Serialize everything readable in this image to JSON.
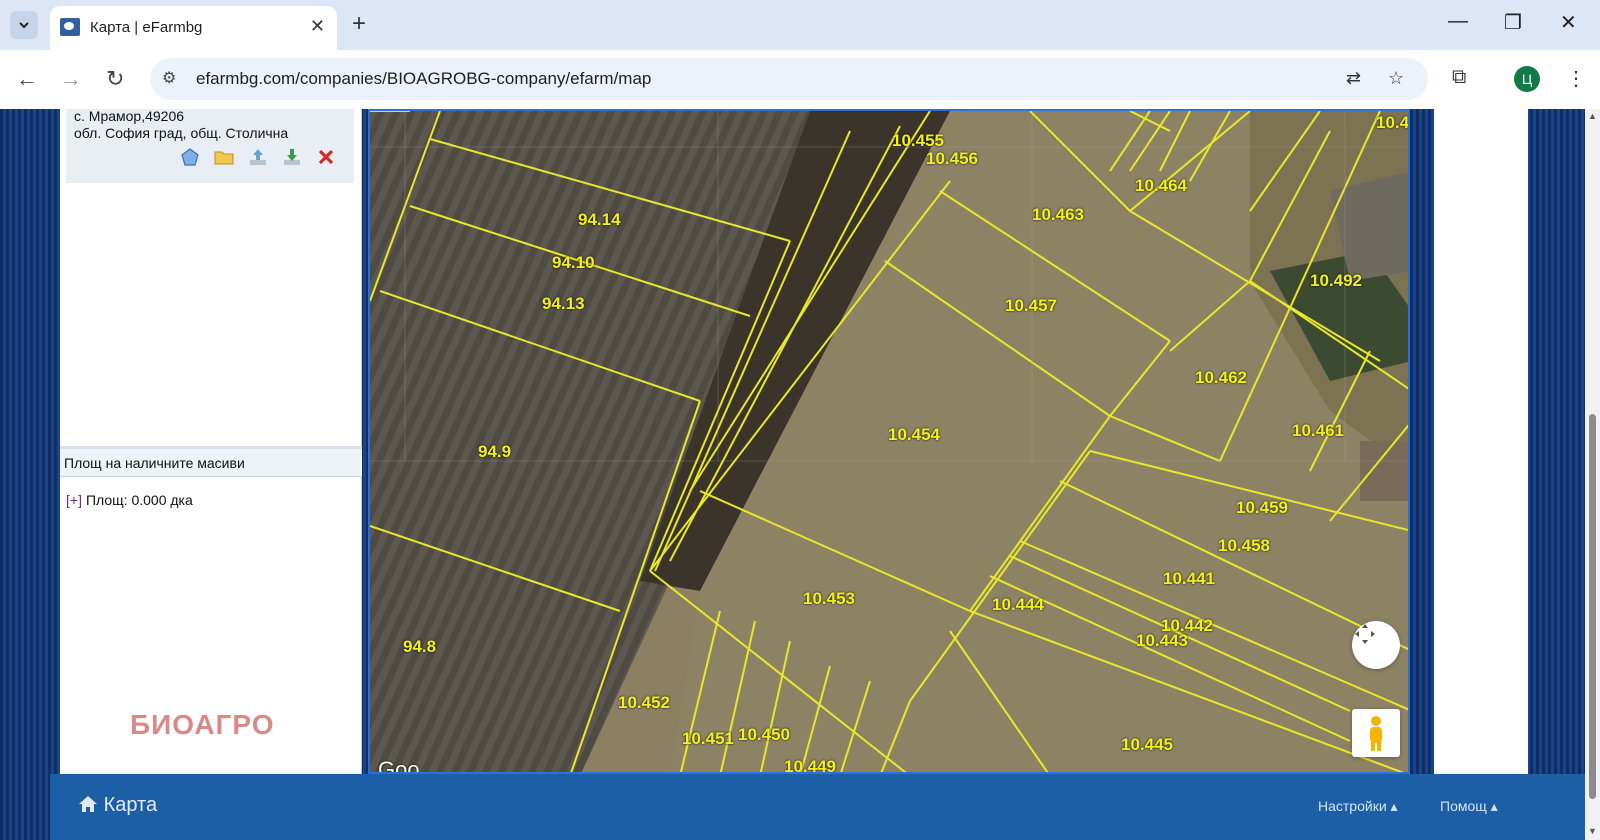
{
  "browser": {
    "tab_title": "Карта | eFarmbg",
    "url": "efarmbg.com/companies/BIOAGROBG-company/efarm/map",
    "profile_letter": "Ц"
  },
  "location": {
    "line1": "с. Мрамор,49206",
    "line2": "обл. София град, общ. Столична"
  },
  "panel": {
    "section_title": "Площ на наличните масиви",
    "area_toggle": "[+]",
    "area_text": "Площ: 0.000 дка",
    "brand": "БИОАГРО"
  },
  "map": {
    "parcels": [
      "10.455",
      "10.456",
      "10.464",
      "10.463",
      "94.14",
      "94.10",
      "94.13",
      "10.492",
      "10.457",
      "10.462",
      "10.461",
      "10.454",
      "94.9",
      "10.459",
      "10.458",
      "10.441",
      "10.453",
      "10.444",
      "10.442",
      "10.443",
      "94.8",
      "10.452",
      "10.445",
      "10.451",
      "10.450",
      "10.449",
      "10.4"
    ],
    "google_mark": "Goo"
  },
  "footer": {
    "home_label": "Карта",
    "settings_label": "Настройки",
    "help_label": "Помощ"
  }
}
